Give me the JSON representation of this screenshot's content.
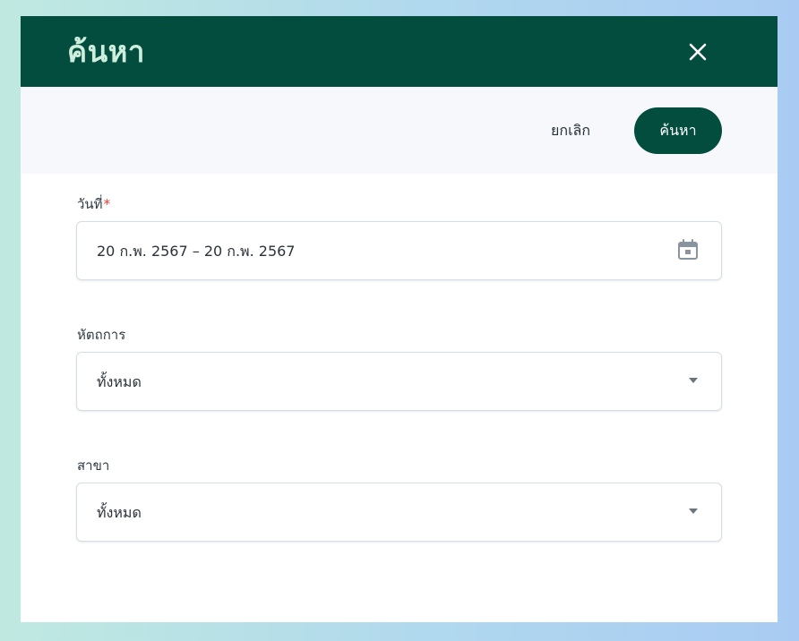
{
  "modal": {
    "title": "ค้นหา",
    "close_icon": "close-icon"
  },
  "actions": {
    "cancel_label": "ยกเลิก",
    "search_label": "ค้นหา"
  },
  "form": {
    "date": {
      "label": "วันที่",
      "required_mark": "*",
      "value": "20 ก.พ. 2567 – 20 ก.พ. 2567",
      "icon": "calendar-icon"
    },
    "operator": {
      "label": "หัตถการ",
      "value": "ทั้งหมด",
      "icon": "chevron-down-icon"
    },
    "branch": {
      "label": "สาขา",
      "value": "ทั้งหมด",
      "icon": "chevron-down-icon"
    }
  },
  "colors": {
    "header_bg": "#034d3f",
    "title_text": "#cdeedd",
    "action_bar_bg": "#f6f8fb",
    "required": "#e53935"
  }
}
